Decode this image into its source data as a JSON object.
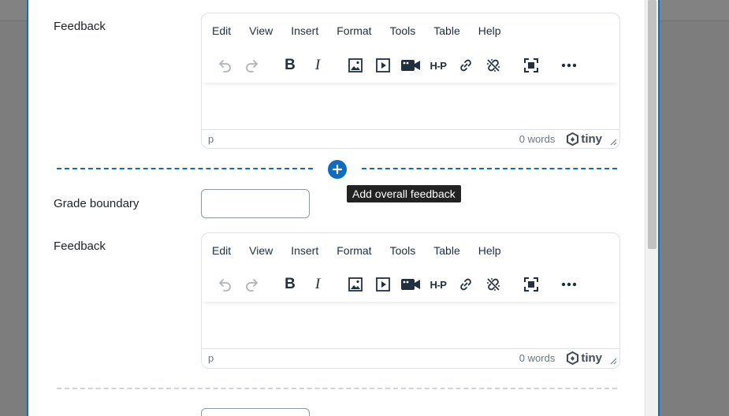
{
  "menu": [
    "Edit",
    "View",
    "Insert",
    "Format",
    "Tools",
    "Table",
    "Help"
  ],
  "toolbar_icons": [
    "undo-icon",
    "redo-icon",
    "bold-icon",
    "italic-icon",
    "image-icon",
    "media-icon",
    "video-camera-icon",
    "h5p-icon",
    "link-icon",
    "unlink-icon",
    "fullscreen-icon",
    "more-icon"
  ],
  "field_labels": {
    "feedback": "Feedback",
    "grade_boundary": "Grade boundary"
  },
  "status": {
    "path": "p",
    "words": "0 words",
    "brand": "tiny"
  },
  "toolbar_text": {
    "bold": "B",
    "italic": "I",
    "h5p": "H-P"
  },
  "add_feedback_tooltip": "Add overall feedback",
  "colors": {
    "accent": "#0f6cbf",
    "tooltip_bg": "#222222"
  }
}
